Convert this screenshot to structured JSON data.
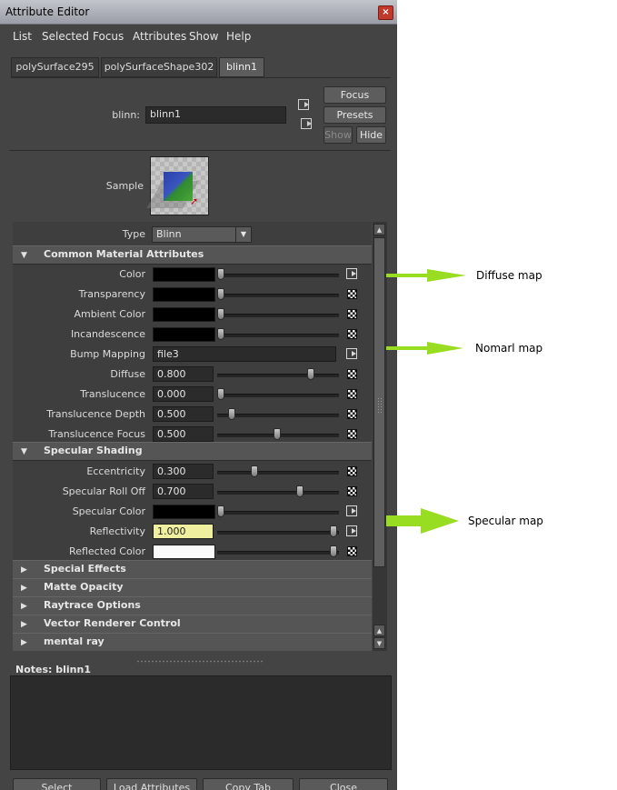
{
  "window": {
    "title": "Attribute Editor",
    "close_glyph": "×"
  },
  "menu": [
    "List",
    "Selected",
    "Focus",
    "Attributes",
    "Show",
    "Help"
  ],
  "tabs": [
    "polySurface295",
    "polySurfaceShape302",
    "blinn1"
  ],
  "active_tab": "blinn1",
  "node": {
    "label": "blinn:",
    "value": "blinn1"
  },
  "buttons": {
    "focus": "Focus",
    "presets": "Presets",
    "show": "Show",
    "hide": "Hide"
  },
  "sample_label": "Sample",
  "type_row": {
    "label": "Type",
    "value": "Blinn"
  },
  "sections": {
    "common": "Common Material Attributes",
    "specular": "Specular Shading",
    "special_effects": "Special Effects",
    "matte_opacity": "Matte Opacity",
    "raytrace_options": "Raytrace Options",
    "vector_renderer": "Vector Renderer Control",
    "mental_ray": "mental ray"
  },
  "common_attrs": [
    {
      "label": "Color",
      "kind": "color",
      "color": "#000000",
      "slider": 0.0
    },
    {
      "label": "Transparency",
      "kind": "color",
      "color": "#000000",
      "slider": 0.0
    },
    {
      "label": "Ambient Color",
      "kind": "color",
      "color": "#000000",
      "slider": 0.0
    },
    {
      "label": "Incandescence",
      "kind": "color",
      "color": "#000000",
      "slider": 0.0
    },
    {
      "label": "Bump Mapping",
      "kind": "text",
      "value": "file3"
    },
    {
      "label": "Diffuse",
      "kind": "num",
      "value": "0.800",
      "slider": 0.8
    },
    {
      "label": "Translucence",
      "kind": "num",
      "value": "0.000",
      "slider": 0.0
    },
    {
      "label": "Translucence Depth",
      "kind": "num",
      "value": "0.500",
      "slider": 0.1
    },
    {
      "label": "Translucence Focus",
      "kind": "num",
      "value": "0.500",
      "slider": 0.5
    }
  ],
  "specular_attrs": [
    {
      "label": "Eccentricity",
      "kind": "num",
      "value": "0.300",
      "slider": 0.3
    },
    {
      "label": "Specular Roll Off",
      "kind": "num",
      "value": "0.700",
      "slider": 0.7
    },
    {
      "label": "Specular Color",
      "kind": "color",
      "color": "#000000",
      "slider": 0.0
    },
    {
      "label": "Reflectivity",
      "kind": "num",
      "value": "1.000",
      "slider": 1.0,
      "highlight": true
    },
    {
      "label": "Reflected Color",
      "kind": "color",
      "color": "#ffffff",
      "slider": 1.0
    }
  ],
  "notes": {
    "label": "Notes:  blinn1"
  },
  "bottom_buttons": [
    "Select",
    "Load Attributes",
    "Copy Tab",
    "Close"
  ],
  "annotations": {
    "diffuse": "Diffuse map",
    "normal": "Nomarl map",
    "specular": "Specular map"
  },
  "colors": {
    "arrow": "#99dd22",
    "panel": "#444444",
    "highlight_field": "#efef9f"
  }
}
